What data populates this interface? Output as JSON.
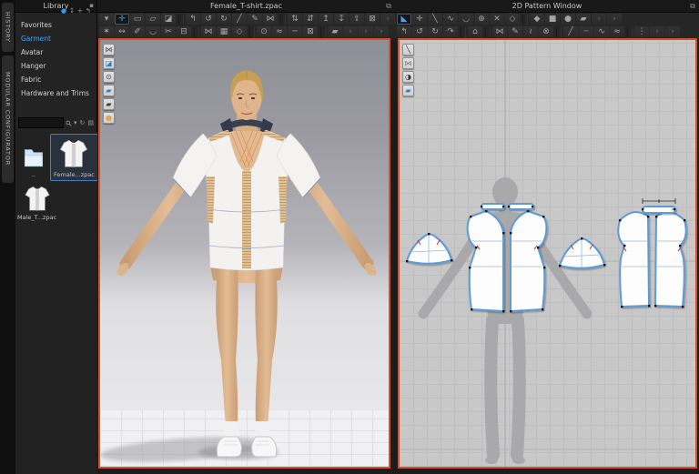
{
  "colors": {
    "accent": "#3fa9f5",
    "viewport_border": "#d6502a",
    "pattern_outline": "#5b9bd5",
    "toolbar_bg": "#262626"
  },
  "left_rail": {
    "tabs": [
      {
        "name": "tab-history",
        "label": "HISTORY"
      },
      {
        "name": "tab-modular-configurator",
        "label": "MODULAR CONFIGURATOR"
      }
    ]
  },
  "library": {
    "title": "Library",
    "menu_icon": "▪",
    "items": [
      {
        "name": "library-item-favorites",
        "label": "Favorites"
      },
      {
        "name": "library-item-garment",
        "label": "Garment",
        "s": true
      },
      {
        "name": "library-item-avatar",
        "label": "Avatar"
      },
      {
        "name": "library-item-hanger",
        "label": "Hanger"
      },
      {
        "name": "library-item-fabric",
        "label": "Fabric"
      },
      {
        "name": "library-item-hardware-trims",
        "label": "Hardware and Trims"
      }
    ],
    "fav_icons": [
      {
        "name": "sync-icon",
        "g": "●",
        "c": "#2f9be8"
      },
      {
        "name": "import-icon",
        "g": "↧"
      },
      {
        "name": "add-icon",
        "g": "+"
      },
      {
        "name": "back-icon",
        "g": "↰"
      }
    ],
    "search": {
      "placeholder": "",
      "icons": [
        {
          "name": "search-dropdown-icon",
          "g": "▾"
        },
        {
          "name": "refresh-icon",
          "g": "↻"
        },
        {
          "name": "view-mode-icon",
          "g": "▤"
        }
      ]
    },
    "thumbnails": [
      {
        "name": "thumb-parent-folder",
        "label": "..",
        "type": "folder"
      },
      {
        "name": "thumb-female-tshirt",
        "label": "Female...zpac",
        "type": "shirt",
        "s": true
      },
      {
        "name": "thumb-male-tshirt",
        "label": "Male_T...zpac",
        "type": "shirt"
      }
    ]
  },
  "view3d": {
    "title": "Female_T-shirt.zpac",
    "popout_icon": "⧉",
    "toolbar1": [
      {
        "name": "simulate-menu-icon",
        "g": "▾"
      },
      {
        "name": "select-move-tool",
        "g": "✛",
        "s": true
      },
      {
        "name": "select-box-tool",
        "g": "▭"
      },
      {
        "name": "transform-pattern-tool",
        "g": "▱"
      },
      {
        "name": "lasso-select-tool",
        "g": "◪"
      },
      {
        "name": "toolbar-divider",
        "d": true
      },
      {
        "name": "fold-arrangement-tool",
        "g": "↰"
      },
      {
        "name": "reset-2d-arrangement-tool",
        "g": "↺"
      },
      {
        "name": "reset-3d-arrangement-tool",
        "g": "↻"
      },
      {
        "name": "sewing-pin-tool",
        "g": "╱"
      },
      {
        "name": "edit-sewing-tool",
        "g": "✎"
      },
      {
        "name": "free-sewing-tool",
        "g": "⋈"
      },
      {
        "name": "toolbar-divider",
        "d": true
      },
      {
        "name": "arrangement-shirts-tool",
        "g": "⇅"
      },
      {
        "name": "arrangement-pants-tool",
        "g": "⇵"
      },
      {
        "name": "garment-up-tool",
        "g": "↥"
      },
      {
        "name": "garment-down-tool",
        "g": "↧"
      },
      {
        "name": "garment-fold-tool",
        "g": "⇪"
      },
      {
        "name": "garment-lock-tool",
        "g": "⊠"
      },
      {
        "name": "overflow-chevron",
        "g": "›",
        "c": "#6e6e6e"
      }
    ],
    "toolbar2": [
      {
        "name": "avatar-display-tool",
        "g": "✶"
      },
      {
        "name": "tape-measure-tool",
        "g": "↔"
      },
      {
        "name": "edit-measure-tool",
        "g": "✐"
      },
      {
        "name": "circumference-measure-tool",
        "g": "◡"
      },
      {
        "name": "scissors-tool",
        "g": "✂"
      },
      {
        "name": "flatten-tool",
        "g": "⊟"
      },
      {
        "name": "toolbar-divider",
        "d": true
      },
      {
        "name": "stitch-view-tool",
        "g": "⋈"
      },
      {
        "name": "texture-view-tool",
        "g": "▦"
      },
      {
        "name": "pattern-3d-tool",
        "g": "◇"
      },
      {
        "name": "toolbar-divider",
        "d": true
      },
      {
        "name": "pin-tool",
        "g": "⊙"
      },
      {
        "name": "wind-tool",
        "g": "≈"
      },
      {
        "name": "line-tool",
        "g": "─"
      },
      {
        "name": "lock-tool",
        "g": "⊠"
      },
      {
        "name": "toolbar-divider",
        "d": true
      },
      {
        "name": "fabric-tool",
        "g": "▰"
      },
      {
        "name": "overflow-chevron",
        "g": "›",
        "c": "#6e6e6e"
      },
      {
        "name": "overflow-chevron",
        "g": "›",
        "c": "#6e6e6e"
      },
      {
        "name": "overflow-chevron",
        "g": "›",
        "c": "#6e6e6e"
      }
    ],
    "side_tools": [
      {
        "name": "show-3d-garment-icon",
        "g": "⋈",
        "c": "#4a4a4a"
      },
      {
        "name": "show-3d-seams-icon",
        "g": "◪",
        "c": "#2f7fd0"
      },
      {
        "name": "show-pins-icon",
        "g": "⊙",
        "c": "#4a4a4a"
      },
      {
        "name": "fabric-front-icon",
        "g": "▰",
        "c": "#2f7fd0"
      },
      {
        "name": "fabric-back-icon",
        "g": "▰",
        "c": "#3c3c3c"
      },
      {
        "name": "show-avatar-icon",
        "g": "●",
        "c": "#e8a24a"
      }
    ]
  },
  "view2d": {
    "title": "2D Pattern Window",
    "popout_icon": "⧉",
    "toolbar1": [
      {
        "name": "transform-pattern-tool",
        "g": "◣",
        "s": true
      },
      {
        "name": "edit-pattern-tool",
        "g": "✛"
      },
      {
        "name": "edit-point-line-tool",
        "g": "╲"
      },
      {
        "name": "edit-curvature-tool",
        "g": "∿"
      },
      {
        "name": "edit-curve-point-tool",
        "g": "◡"
      },
      {
        "name": "add-point-tool",
        "g": "⊕"
      },
      {
        "name": "split-line-tool",
        "g": "✕"
      },
      {
        "name": "trace-tool",
        "g": "◇"
      },
      {
        "name": "toolbar-divider",
        "d": true
      },
      {
        "name": "polygon-pattern-tool",
        "g": "◆"
      },
      {
        "name": "rectangle-pattern-tool",
        "g": "■"
      },
      {
        "name": "circle-pattern-tool",
        "g": "●"
      },
      {
        "name": "shape-pattern-tool",
        "g": "▰"
      },
      {
        "name": "overflow-chevron",
        "g": "›",
        "c": "#6e6e6e"
      },
      {
        "name": "overflow-chevron",
        "g": "›",
        "c": "#6e6e6e"
      }
    ],
    "toolbar2": [
      {
        "name": "fold-dart-tool",
        "g": "↰"
      },
      {
        "name": "unfold-left-tool",
        "g": "↺"
      },
      {
        "name": "unfold-right-tool",
        "g": "↻"
      },
      {
        "name": "rotate-pattern-tool",
        "g": "↷"
      },
      {
        "name": "toolbar-divider",
        "d": true
      },
      {
        "name": "iron-tool",
        "g": "⌂"
      },
      {
        "name": "toolbar-divider",
        "d": true
      },
      {
        "name": "sew-garment-tool",
        "g": "⋈"
      },
      {
        "name": "segment-sewing-tool",
        "g": "✎"
      },
      {
        "name": "free-sewing-tool",
        "g": "≀"
      },
      {
        "name": "detail-sewing-tool",
        "g": "⊗"
      },
      {
        "name": "toolbar-divider",
        "d": true
      },
      {
        "name": "seam-line-tool",
        "g": "╱"
      },
      {
        "name": "basting-tool",
        "g": "┄"
      },
      {
        "name": "elastic-tool",
        "g": "∿"
      },
      {
        "name": "shirring-tool",
        "g": "≈"
      },
      {
        "name": "toolbar-divider",
        "d": true
      },
      {
        "name": "grading-tool",
        "g": "⋮"
      },
      {
        "name": "overflow-chevron",
        "g": "›",
        "c": "#6e6e6e"
      },
      {
        "name": "overflow-chevron",
        "g": "›",
        "c": "#6e6e6e"
      }
    ],
    "side_tools": [
      {
        "name": "edit-sewing-icon",
        "g": "╲",
        "c": "#333333"
      },
      {
        "name": "show-2d-garment-icon",
        "g": "⋈",
        "c": "#777777"
      },
      {
        "name": "show-texture-icon",
        "g": "◑",
        "c": "#333333"
      },
      {
        "name": "fabric-swatch-icon",
        "g": "▰",
        "c": "#2f7fd0"
      }
    ]
  }
}
